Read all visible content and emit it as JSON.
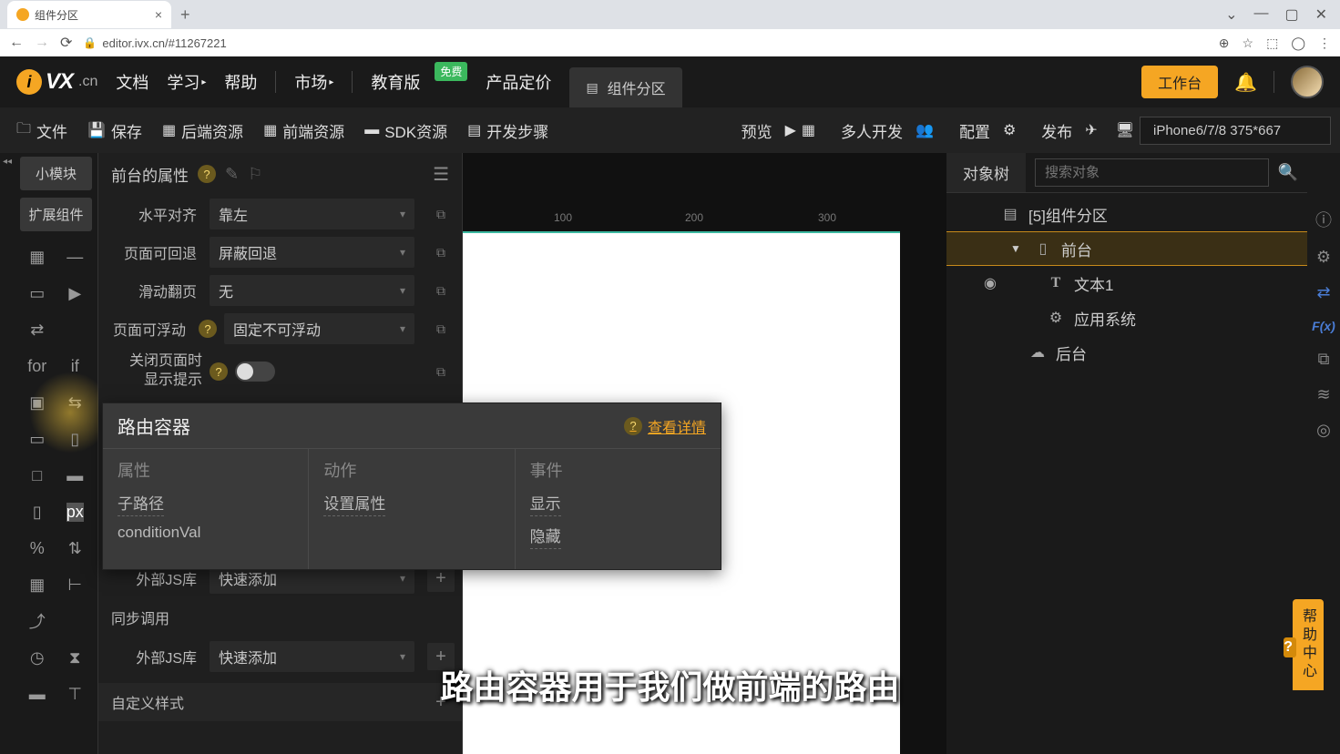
{
  "browser": {
    "tab_title": "组件分区",
    "url": "editor.ivx.cn/#11267221"
  },
  "header": {
    "logo_text": "VX",
    "logo_cn": ".cn",
    "nav": {
      "docs": "文档",
      "learn": "学习",
      "help": "帮助",
      "market": "市场",
      "edu": "教育版",
      "free": "免费",
      "pricing": "产品定价",
      "component": "组件分区"
    },
    "workspace_btn": "工作台"
  },
  "toolbar": {
    "file": "文件",
    "save": "保存",
    "backend": "后端资源",
    "frontend": "前端资源",
    "sdk": "SDK资源",
    "steps": "开发步骤",
    "preview": "预览",
    "multi": "多人开发",
    "config": "配置",
    "publish": "发布",
    "device": "iPhone6/7/8 375*667"
  },
  "left_rail": {
    "small_module": "小模块",
    "ext_component": "扩展组件"
  },
  "props": {
    "title": "前台的属性",
    "rows": {
      "halign": {
        "label": "水平对齐",
        "value": "靠左"
      },
      "back": {
        "label": "页面可回退",
        "value": "屏蔽回退"
      },
      "swipe": {
        "label": "滑动翻页",
        "value": "无"
      },
      "float": {
        "label": "页面可浮动",
        "value": "固定不可浮动"
      },
      "closehint": {
        "label1": "关闭页面时",
        "label2": "显示提示"
      }
    },
    "extjs": {
      "label": "外部JS库",
      "value": "快速添加"
    },
    "sync_call": "同步调用",
    "extjs2": {
      "label": "外部JS库",
      "value": "快速添加"
    },
    "custom_style": "自定义样式"
  },
  "popup": {
    "title": "路由容器",
    "detail": "查看详情",
    "col1": {
      "title": "属性",
      "items": [
        "子路径",
        "conditionVal"
      ]
    },
    "col2": {
      "title": "动作",
      "items": [
        "设置属性"
      ]
    },
    "col3": {
      "title": "事件",
      "items": [
        "显示",
        "隐藏"
      ]
    }
  },
  "right": {
    "tab": "对象树",
    "search_placeholder": "搜索对象",
    "root": "[5]组件分区",
    "nodes": {
      "frontend": "前台",
      "text1": "文本1",
      "appsys": "应用系统",
      "backend": "后台"
    }
  },
  "ruler": {
    "r100": "100",
    "r200": "200",
    "r300": "300"
  },
  "subtitle": "路由容器用于我们做前端的路由",
  "help_center": "帮助中心"
}
